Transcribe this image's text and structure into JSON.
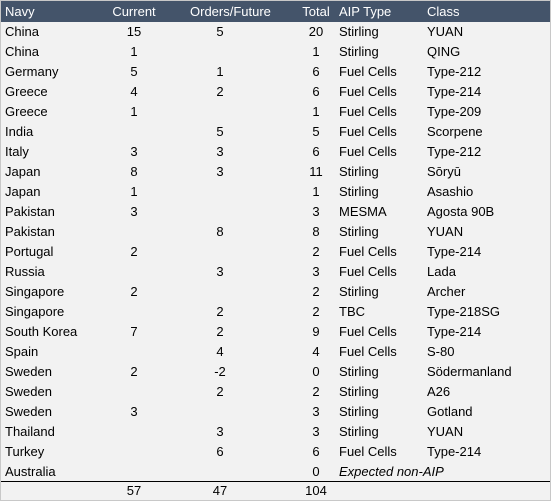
{
  "header": {
    "navy": "Navy",
    "current": "Current",
    "orders": "Orders/Future",
    "total": "Total",
    "aip": "AIP Type",
    "class": "Class"
  },
  "rows": [
    [
      "China",
      "15",
      "5",
      "20",
      "Stirling",
      "YUAN"
    ],
    [
      "China",
      "1",
      "",
      "1",
      "Stirling",
      "QING"
    ],
    [
      "Germany",
      "5",
      "1",
      "6",
      "Fuel Cells",
      "Type-212"
    ],
    [
      "Greece",
      "4",
      "2",
      "6",
      "Fuel Cells",
      "Type-214"
    ],
    [
      "Greece",
      "1",
      "",
      "1",
      "Fuel Cells",
      "Type-209"
    ],
    [
      "India",
      "",
      "5",
      "5",
      "Fuel Cells",
      "Scorpene"
    ],
    [
      "Italy",
      "3",
      "3",
      "6",
      "Fuel Cells",
      "Type-212"
    ],
    [
      "Japan",
      "8",
      "3",
      "11",
      "Stirling",
      "Sōryū"
    ],
    [
      "Japan",
      "1",
      "",
      "1",
      "Stirling",
      "Asashio"
    ],
    [
      "Pakistan",
      "3",
      "",
      "3",
      "MESMA",
      "Agosta 90B"
    ],
    [
      "Pakistan",
      "",
      "8",
      "8",
      "Stirling",
      "YUAN"
    ],
    [
      "Portugal",
      "2",
      "",
      "2",
      "Fuel Cells",
      "Type-214"
    ],
    [
      "Russia",
      "",
      "3",
      "3",
      "Fuel Cells",
      "Lada"
    ],
    [
      "Singapore",
      "2",
      "",
      "2",
      "Stirling",
      "Archer"
    ],
    [
      "Singapore",
      "",
      "2",
      "2",
      "TBC",
      "Type-218SG"
    ],
    [
      "South Korea",
      "7",
      "2",
      "9",
      "Fuel Cells",
      "Type-214"
    ],
    [
      "Spain",
      "",
      "4",
      "4",
      "Fuel Cells",
      "S-80"
    ],
    [
      "Sweden",
      "2",
      "-2",
      "0",
      "Stirling",
      "Södermanland"
    ],
    [
      "Sweden",
      "",
      "2",
      "2",
      "Stirling",
      "A26"
    ],
    [
      "Sweden",
      "3",
      "",
      "3",
      "Stirling",
      "Gotland"
    ],
    [
      "Thailand",
      "",
      "3",
      "3",
      "Stirling",
      "YUAN"
    ],
    [
      "Turkey",
      "",
      "6",
      "6",
      "Fuel Cells",
      "Type-214"
    ]
  ],
  "australia": {
    "navy": "Australia",
    "total": "0",
    "note": "Expected non-AIP"
  },
  "totals": {
    "current": "57",
    "orders": "47",
    "total": "104"
  }
}
